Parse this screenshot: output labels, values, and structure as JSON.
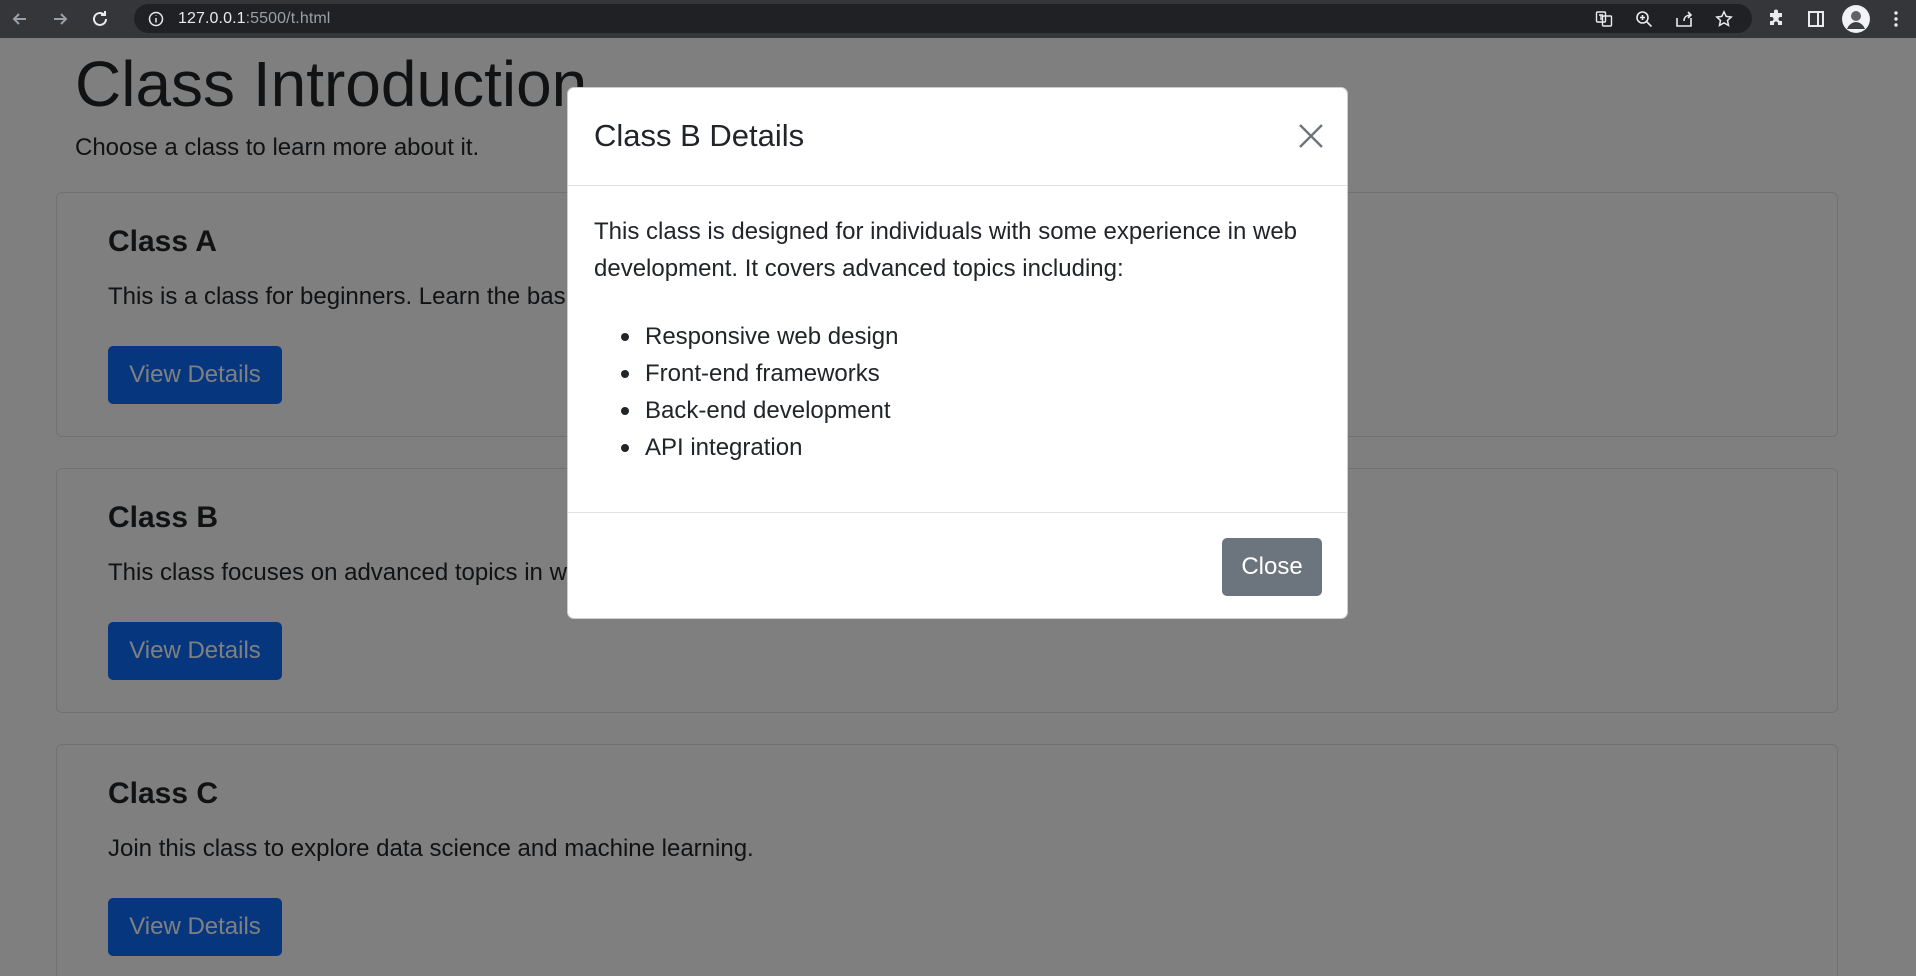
{
  "browser": {
    "url_host": "127.0.0.1",
    "url_rest": ":5500/t.html"
  },
  "page": {
    "title": "Class Introduction",
    "subtitle": "Choose a class to learn more about it.",
    "cards": [
      {
        "title": "Class A",
        "text": "This is a class for beginners. Learn the basics of programming.",
        "button": "View Details"
      },
      {
        "title": "Class B",
        "text": "This class focuses on advanced topics in web development.",
        "button": "View Details"
      },
      {
        "title": "Class C",
        "text": "Join this class to explore data science and machine learning.",
        "button": "View Details"
      }
    ]
  },
  "modal": {
    "title": "Class B Details",
    "description": "This class is designed for individuals with some experience in web development. It covers advanced topics including:",
    "topics": [
      "Responsive web design",
      "Front-end frameworks",
      "Back-end development",
      "API integration"
    ],
    "close_label": "Close"
  },
  "colors": {
    "primary": "#0d6efd",
    "secondary": "#6c757d",
    "backdrop": "rgba(0,0,0,0.5)"
  }
}
